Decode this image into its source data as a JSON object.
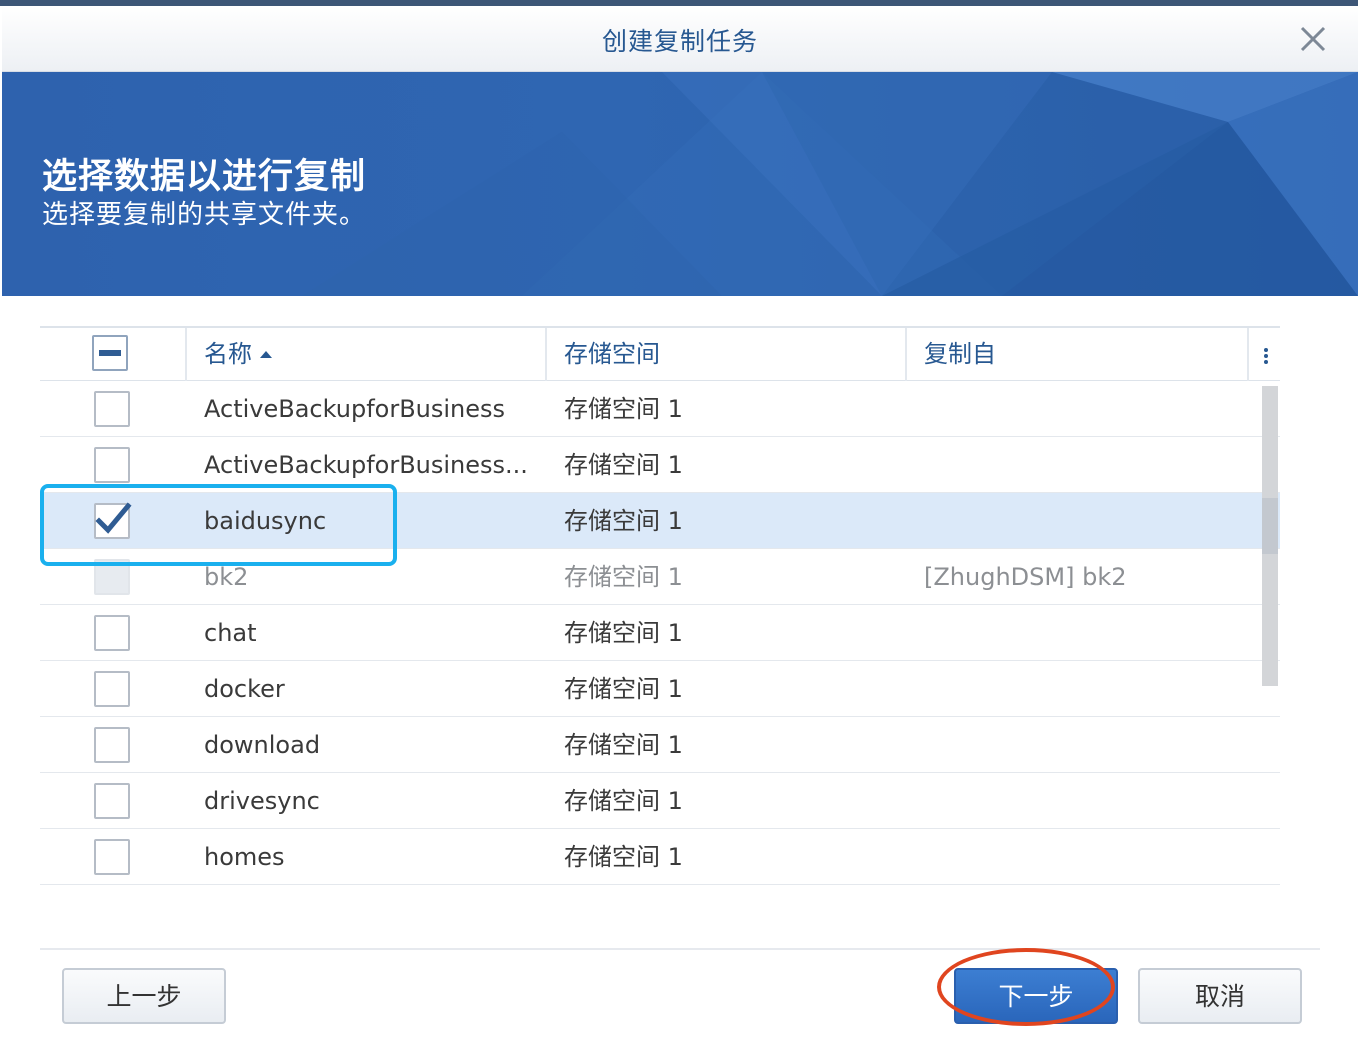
{
  "dialog": {
    "title": "创建复制任务",
    "close_icon": "close-icon"
  },
  "banner": {
    "title": "选择数据以进行复制",
    "subtitle": "选择要复制的共享文件夹。"
  },
  "table": {
    "select_all_state": "partial",
    "columns": {
      "name": "名称",
      "volume": "存储空间",
      "replicated_from": "复制自",
      "sort_icon": "sort-ascending-icon",
      "menu_icon": "column-menu-icon"
    },
    "rows": [
      {
        "name": "ActiveBackupforBusiness",
        "volume": "存储空间 1",
        "replicated_from": "",
        "checked": false,
        "disabled": false
      },
      {
        "name": "ActiveBackupforBusiness...",
        "volume": "存储空间 1",
        "replicated_from": "",
        "checked": false,
        "disabled": false
      },
      {
        "name": "baidusync",
        "volume": "存储空间 1",
        "replicated_from": "",
        "checked": true,
        "disabled": false
      },
      {
        "name": "bk2",
        "volume": "存储空间 1",
        "replicated_from": "[ZhughDSM] bk2",
        "checked": false,
        "disabled": true
      },
      {
        "name": "chat",
        "volume": "存储空间 1",
        "replicated_from": "",
        "checked": false,
        "disabled": false
      },
      {
        "name": "docker",
        "volume": "存储空间 1",
        "replicated_from": "",
        "checked": false,
        "disabled": false
      },
      {
        "name": "download",
        "volume": "存储空间 1",
        "replicated_from": "",
        "checked": false,
        "disabled": false
      },
      {
        "name": "drivesync",
        "volume": "存储空间 1",
        "replicated_from": "",
        "checked": false,
        "disabled": false
      },
      {
        "name": "homes",
        "volume": "存储空间 1",
        "replicated_from": "",
        "checked": false,
        "disabled": false
      }
    ]
  },
  "footer": {
    "back_label": "上一步",
    "next_label": "下一步",
    "cancel_label": "取消"
  },
  "colors": {
    "accent": "#275891",
    "banner_blue": "#2e62ae",
    "selected_row": "#dbe9f9",
    "highlight_box": "#1ab0ee",
    "highlight_ellipse": "#e0451f"
  }
}
